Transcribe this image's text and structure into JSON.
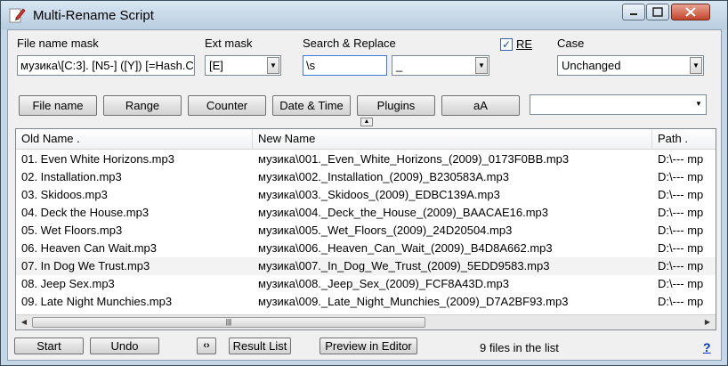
{
  "window": {
    "title": "Multi-Rename Script"
  },
  "mask": {
    "file_label": "File name mask",
    "file_value": "музика\\[C:3]. [N5-] ([Y]) [=Hash.C",
    "ext_label": "Ext mask",
    "ext_value": "[E]"
  },
  "search": {
    "label": "Search & Replace",
    "search_value": "\\s",
    "replace_value": "_",
    "re_label": "RE",
    "re_checked": true
  },
  "case": {
    "label": "Case",
    "value": "Unchanged"
  },
  "buttons": {
    "file_name": "File name",
    "range": "Range",
    "counter": "Counter",
    "date_time": "Date & Time",
    "plugins": "Plugins",
    "aa": "aA"
  },
  "list": {
    "columns": [
      "Old Name .",
      "New Name",
      "Path ."
    ],
    "rows": [
      {
        "old": "01. Even White Horizons.mp3",
        "new": "музика\\001._Even_White_Horizons_(2009)_0173F0BB.mp3",
        "path": "D:\\---  mp"
      },
      {
        "old": "02. Installation.mp3",
        "new": "музика\\002._Installation_(2009)_B230583A.mp3",
        "path": "D:\\---  mp"
      },
      {
        "old": "03. Skidoos.mp3",
        "new": "музика\\003._Skidoos_(2009)_EDBC139A.mp3",
        "path": "D:\\---  mp"
      },
      {
        "old": "04. Deck the House.mp3",
        "new": "музика\\004._Deck_the_House_(2009)_BAACAE16.mp3",
        "path": "D:\\---  mp"
      },
      {
        "old": "05. Wet Floors.mp3",
        "new": "музика\\005._Wet_Floors_(2009)_24D20504.mp3",
        "path": "D:\\---  mp"
      },
      {
        "old": "06. Heaven Can Wait.mp3",
        "new": "музика\\006._Heaven_Can_Wait_(2009)_B4D8A662.mp3",
        "path": "D:\\---  mp"
      },
      {
        "old": "07. In Dog We Trust.mp3",
        "new": "музика\\007._In_Dog_We_Trust_(2009)_5EDD9583.mp3",
        "path": "D:\\---  mp"
      },
      {
        "old": "08. Jeep Sex.mp3",
        "new": "музика\\008._Jeep_Sex_(2009)_FCF8A43D.mp3",
        "path": "D:\\---  mp"
      },
      {
        "old": "09. Late Night Munchies.mp3",
        "new": "музика\\009._Late_Night_Munchies_(2009)_D7A2BF93.mp3",
        "path": "D:\\---  mp"
      }
    ]
  },
  "footer": {
    "start": "Start",
    "undo": "Undo",
    "swap": "‹›",
    "result_list": "Result List",
    "preview": "Preview in Editor",
    "status": "9 files in the list",
    "help": "?"
  }
}
